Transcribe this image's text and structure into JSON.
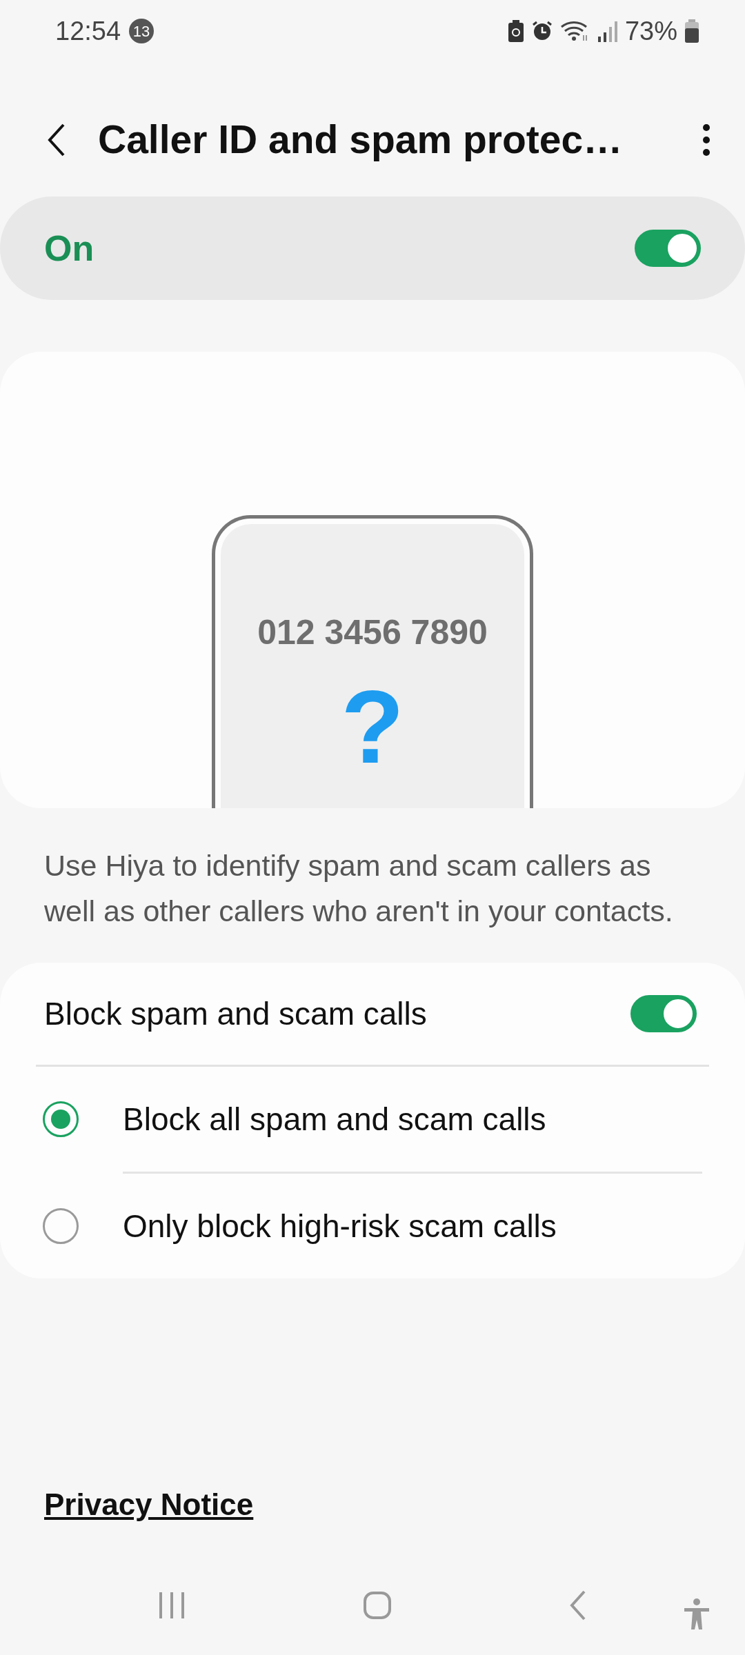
{
  "status_bar": {
    "time": "12:54",
    "notification_count": "13",
    "battery": "73%"
  },
  "header": {
    "title": "Caller ID and spam protec…"
  },
  "master_switch": {
    "label": "On",
    "on": true
  },
  "illustration": {
    "phone_number": "012 3456 7890",
    "symbol": "?"
  },
  "description": "Use Hiya to identify spam and scam callers as well as other callers who aren't in your contacts.",
  "block_setting": {
    "label": "Block spam and scam calls",
    "on": true
  },
  "options": [
    {
      "label": "Block all spam and scam calls",
      "selected": true
    },
    {
      "label": "Only block high-risk scam calls",
      "selected": false
    }
  ],
  "privacy_link": "Privacy Notice"
}
